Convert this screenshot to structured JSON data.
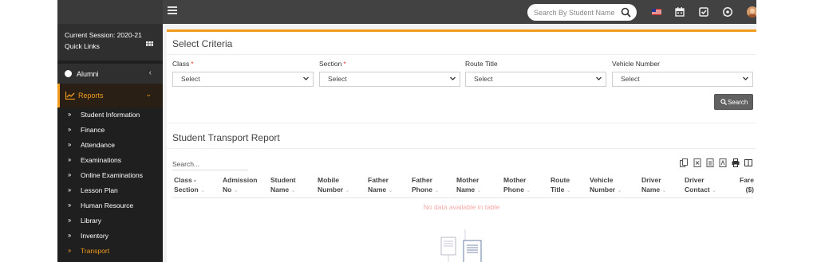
{
  "topbar": {
    "search_placeholder": "Search By Student Name",
    "icons": [
      "flag-icon",
      "calendar-icon",
      "task-icon",
      "whatsapp-icon",
      "avatar"
    ]
  },
  "sidebar": {
    "session_label": "Current Session: 2020-21",
    "quick_links": "Quick Links",
    "alumni": "Alumni",
    "reports": "Reports",
    "report_items": [
      "Student Information",
      "Finance",
      "Attendance",
      "Examinations",
      "Online Examinations",
      "Lesson Plan",
      "Human Resource",
      "Library",
      "Inventory",
      "Transport"
    ],
    "active_item": "Transport"
  },
  "criteria": {
    "title": "Select Criteria",
    "fields": [
      {
        "label": "Class",
        "required": true,
        "value": "Select"
      },
      {
        "label": "Section",
        "required": true,
        "value": "Select"
      },
      {
        "label": "Route Title",
        "required": false,
        "value": "Select"
      },
      {
        "label": "Vehicle Number",
        "required": false,
        "value": "Select"
      }
    ],
    "required_mark": "*",
    "search_button": "Search"
  },
  "report": {
    "title": "Student Transport Report",
    "search_placeholder": "Search...",
    "columns": [
      [
        "Class -",
        "Section"
      ],
      [
        "Admission",
        "No"
      ],
      [
        "Student",
        "Name"
      ],
      [
        "Mobile",
        "Number"
      ],
      [
        "Father",
        "Name"
      ],
      [
        "Father",
        "Phone"
      ],
      [
        "Mother",
        "Name"
      ],
      [
        "Mother",
        "Phone"
      ],
      [
        "Route",
        "Title"
      ],
      [
        "Vehicle",
        "Number"
      ],
      [
        "Driver",
        "Name"
      ],
      [
        "Driver",
        "Contact"
      ],
      [
        "Fare",
        "($)"
      ]
    ],
    "empty_message": "No data available in table"
  },
  "colors": {
    "accent": "#f29c1f",
    "topbar": "#424242",
    "sidebar": "#1f1f1f",
    "empty_text": "#f4a8a8"
  }
}
